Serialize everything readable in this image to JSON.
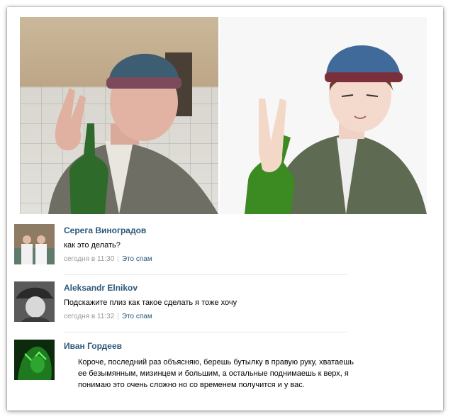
{
  "comments": [
    {
      "author": "Серега Виноградов",
      "text": "как это делать?",
      "time": "сегодня в 11:30",
      "spam_label": "Это спам"
    },
    {
      "author": "Aleksandr Elnikov",
      "text": "Подскажите плиз как такое сделать я тоже хочу",
      "time": "сегодня в 11:32",
      "spam_label": "Это спам"
    },
    {
      "author": "Иван Гордеев",
      "text": "Короче, последний раз объясняю, берешь бутылку в правую руку, хватаешь ее безымянным, мизинцем и большим, а остальные поднимаешь к верх, я понимаю это очень сложно но со временем получится и у вас."
    }
  ],
  "colors": {
    "author": "#2b587a",
    "meta": "#999999",
    "divider": "#e7eaed"
  }
}
